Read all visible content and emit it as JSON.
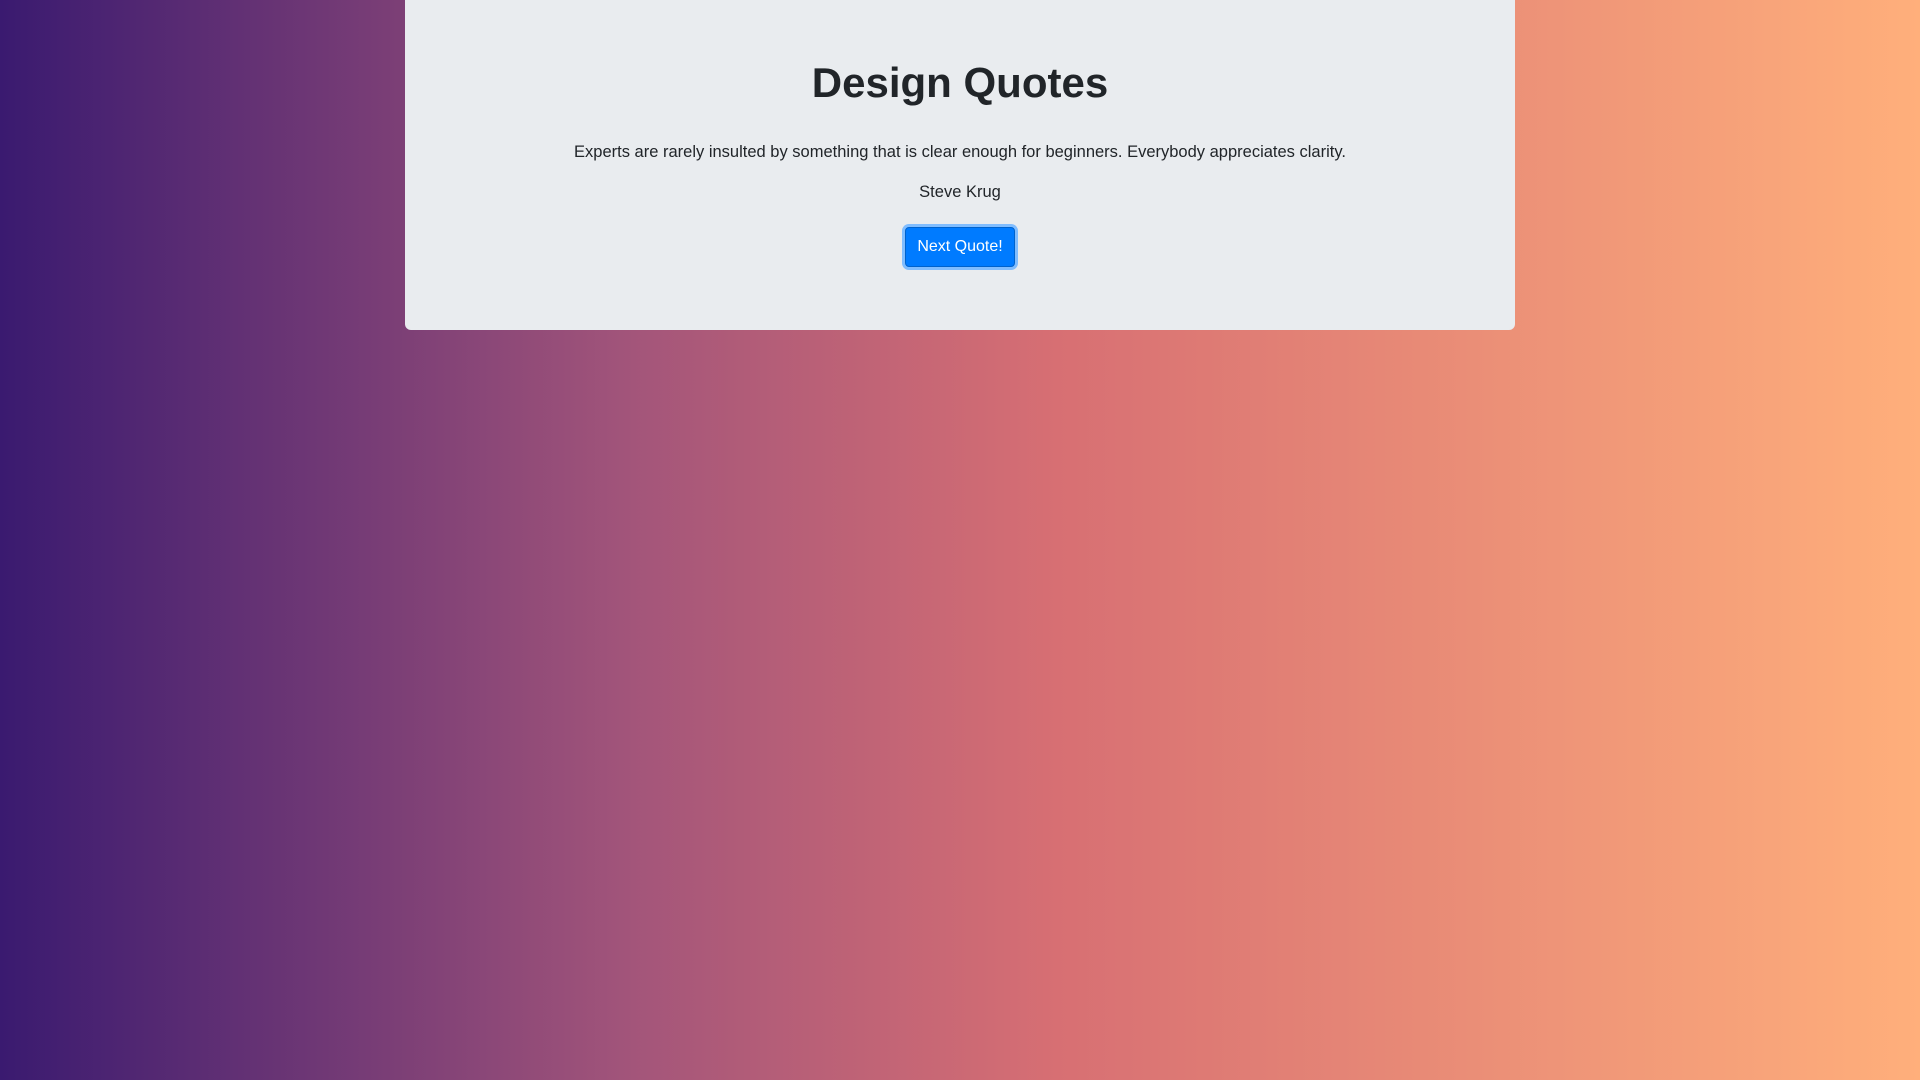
{
  "colors": {
    "gradient_stops": [
      "#3a1a70",
      "#a3557a",
      "#d76f73",
      "#ffaf7b"
    ],
    "card_background": "#e9ecef",
    "button_primary": "#007bff",
    "button_focus_ring": "#80bdff",
    "text": "#212529"
  },
  "quote_box": {
    "title": "Design Quotes",
    "quote": "Experts are rarely insulted by something that is clear enough for beginners. Everybody appreciates clarity.",
    "author": "Steve Krug",
    "button_label": "Next Quote!"
  }
}
